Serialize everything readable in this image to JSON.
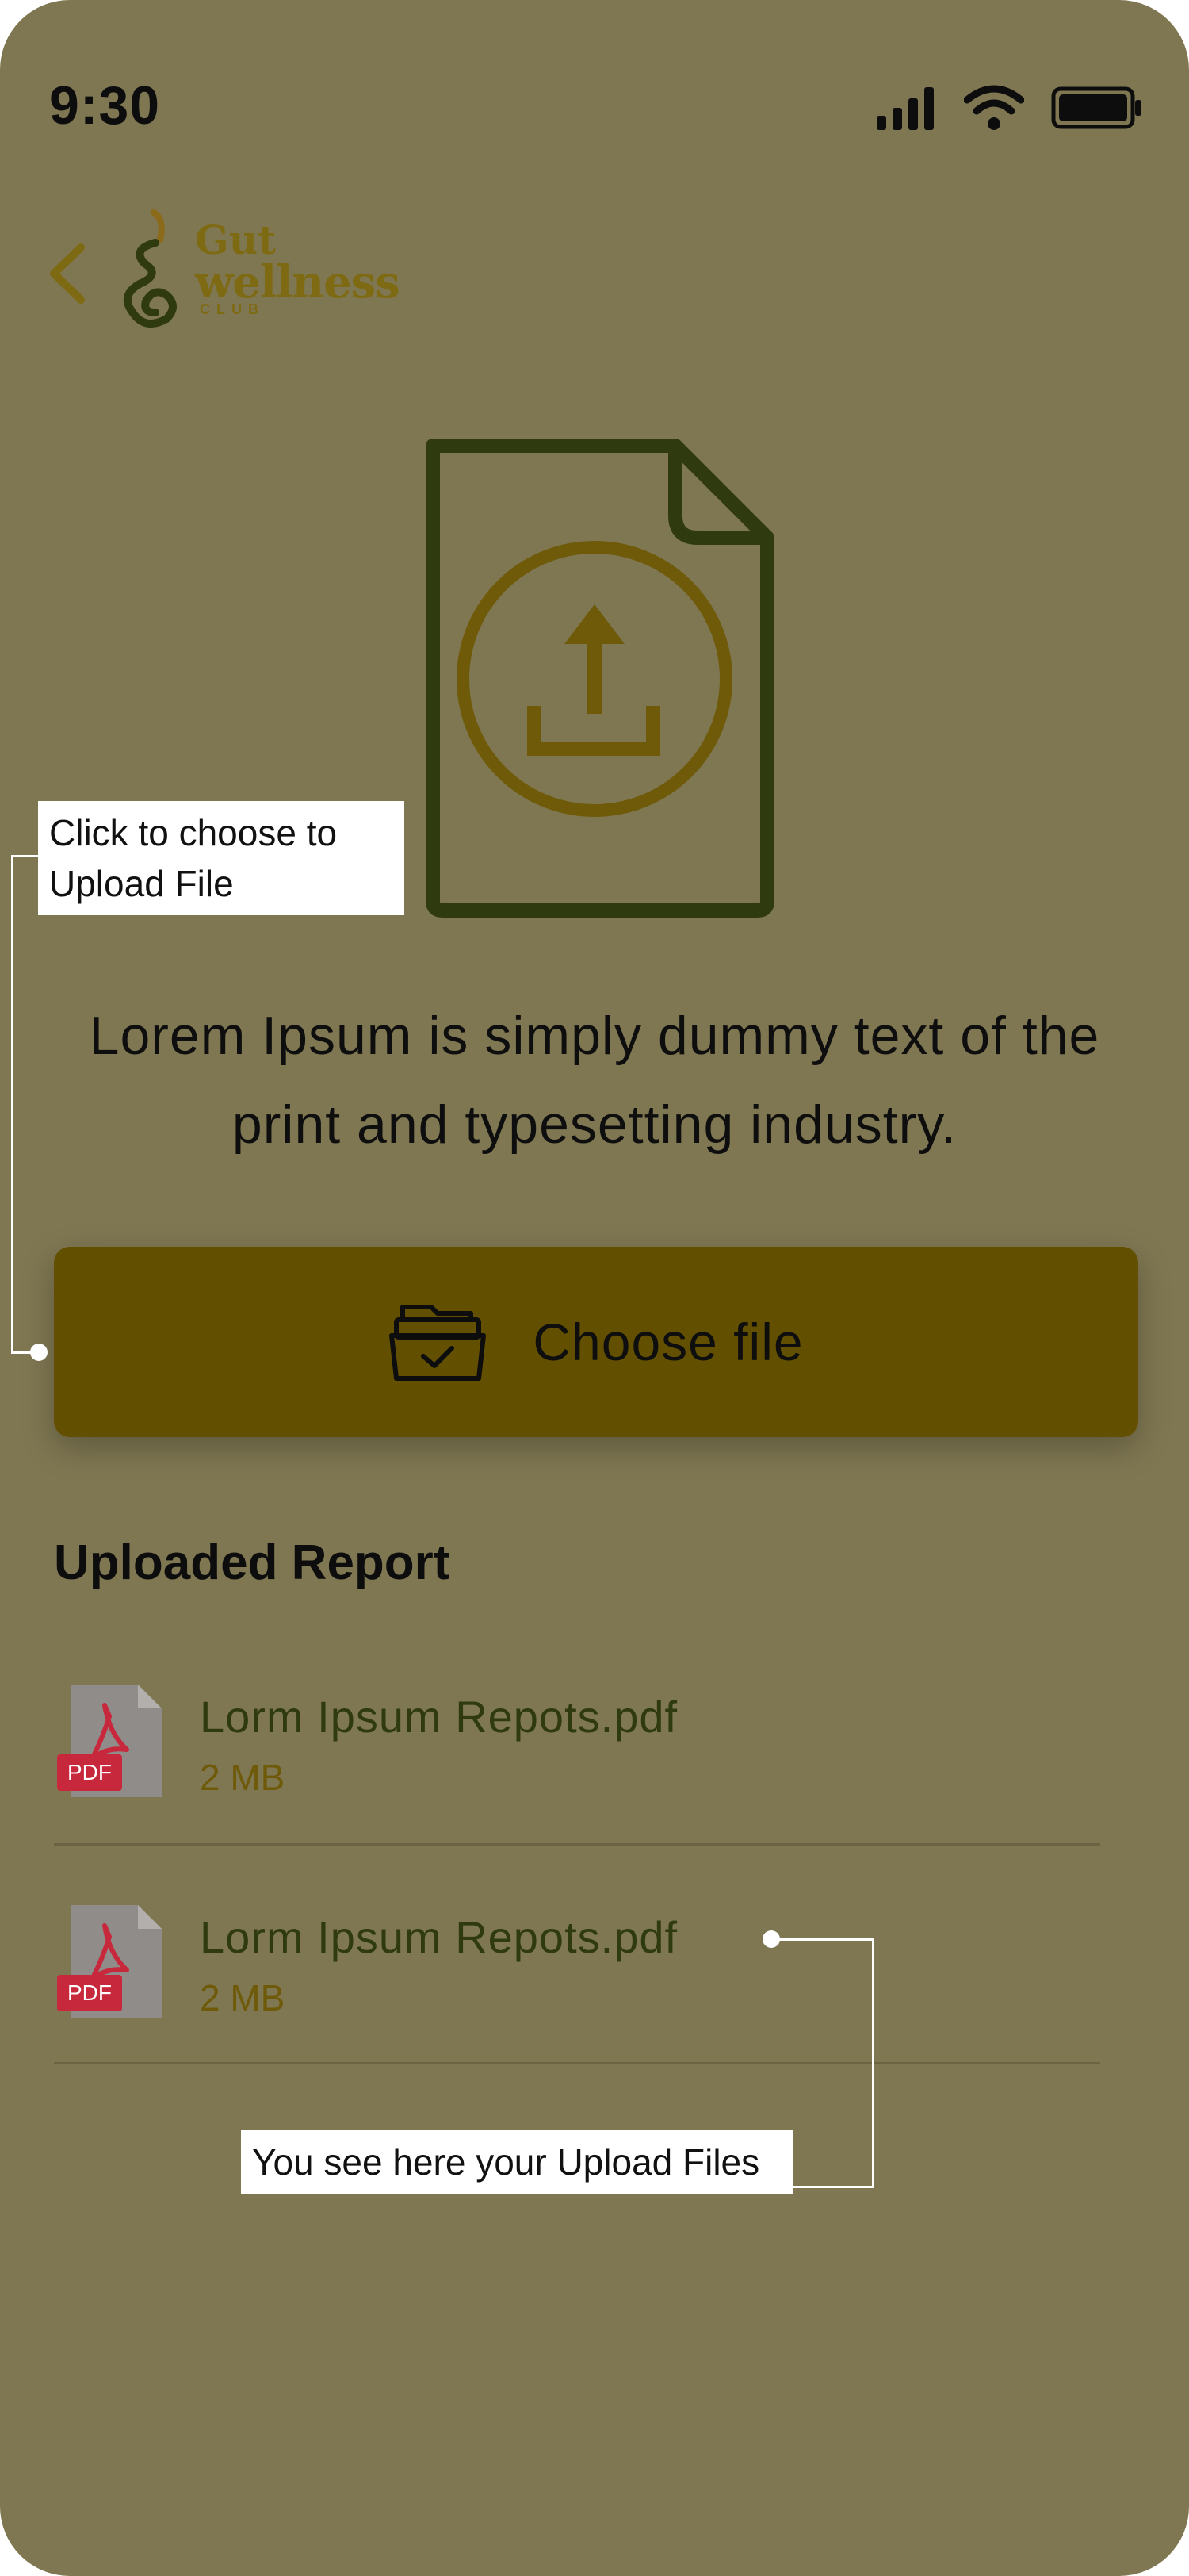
{
  "status_bar": {
    "time": "9:30"
  },
  "header": {
    "logo": {
      "line1": "Gut",
      "line2": "wellness",
      "line3": "CLUB"
    }
  },
  "upload": {
    "headline": "Lorem Ipsum is simply dummy text of the print and typesetting industry.",
    "choose_label": "Choose file"
  },
  "report": {
    "title": "Uploaded Report",
    "files": [
      {
        "name": "Lorm Ipsum Repots.pdf",
        "size": "2 MB",
        "icon_label": "PDF"
      },
      {
        "name": "Lorm Ipsum Repots.pdf",
        "size": "2 MB",
        "icon_label": "PDF"
      }
    ]
  },
  "annotations": {
    "upload_hint": "Click to choose to Upload File",
    "files_hint": "You see here your Upload Files"
  },
  "colors": {
    "background": "#7f7752",
    "accent": "#625000",
    "logo": "#7e6a12",
    "icon_green": "#2f3a0f",
    "pdf_red": "#c8283c"
  }
}
